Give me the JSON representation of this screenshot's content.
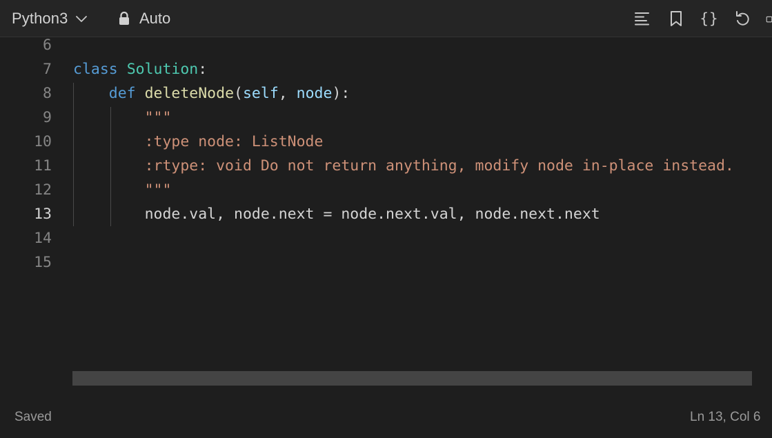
{
  "toolbar": {
    "language": "Python3",
    "mode": "Auto",
    "icons": [
      "chevron-down-icon",
      "lock-icon",
      "format-icon",
      "bookmark-icon",
      "braces-icon",
      "undo-icon"
    ],
    "braces_glyph": "{}"
  },
  "editor": {
    "active_line": "13",
    "lines": [
      {
        "num": "6",
        "tokens": []
      },
      {
        "num": "7",
        "tokens": [
          {
            "t": "class",
            "c": "kw"
          },
          {
            "t": " ",
            "c": "plain"
          },
          {
            "t": "Solution",
            "c": "cls"
          },
          {
            "t": ":",
            "c": "punc"
          }
        ]
      },
      {
        "num": "8",
        "tokens": [
          {
            "t": "    ",
            "c": "plain"
          },
          {
            "t": "def",
            "c": "kw"
          },
          {
            "t": " ",
            "c": "plain"
          },
          {
            "t": "deleteNode",
            "c": "fn"
          },
          {
            "t": "(",
            "c": "punc"
          },
          {
            "t": "self",
            "c": "param"
          },
          {
            "t": ", ",
            "c": "punc"
          },
          {
            "t": "node",
            "c": "param"
          },
          {
            "t": "):",
            "c": "punc"
          }
        ]
      },
      {
        "num": "9",
        "tokens": [
          {
            "t": "        ",
            "c": "plain"
          },
          {
            "t": "\"\"\"",
            "c": "str"
          }
        ]
      },
      {
        "num": "10",
        "tokens": [
          {
            "t": "        ",
            "c": "plain"
          },
          {
            "t": ":type node: ListNode",
            "c": "str"
          }
        ]
      },
      {
        "num": "11",
        "tokens": [
          {
            "t": "        ",
            "c": "plain"
          },
          {
            "t": ":rtype: void Do not return anything, modify node in-place instead.",
            "c": "str"
          }
        ]
      },
      {
        "num": "12",
        "tokens": [
          {
            "t": "        ",
            "c": "plain"
          },
          {
            "t": "\"\"\"",
            "c": "str"
          }
        ]
      },
      {
        "num": "13",
        "tokens": [
          {
            "t": "        ",
            "c": "plain"
          },
          {
            "t": "node.val, node.next = node.next.val, node.next.next",
            "c": "plain"
          }
        ]
      },
      {
        "num": "14",
        "tokens": []
      },
      {
        "num": "15",
        "tokens": []
      }
    ]
  },
  "status": {
    "saved": "Saved",
    "cursor": "Ln 13, Col 6"
  },
  "colors": {
    "keyword": "#569cd6",
    "class_name": "#4ec9b0",
    "function": "#dcdcaa",
    "parameter": "#9cdcfe",
    "string": "#ce9178",
    "text": "#d4d4d4",
    "background": "#1e1e1e"
  }
}
